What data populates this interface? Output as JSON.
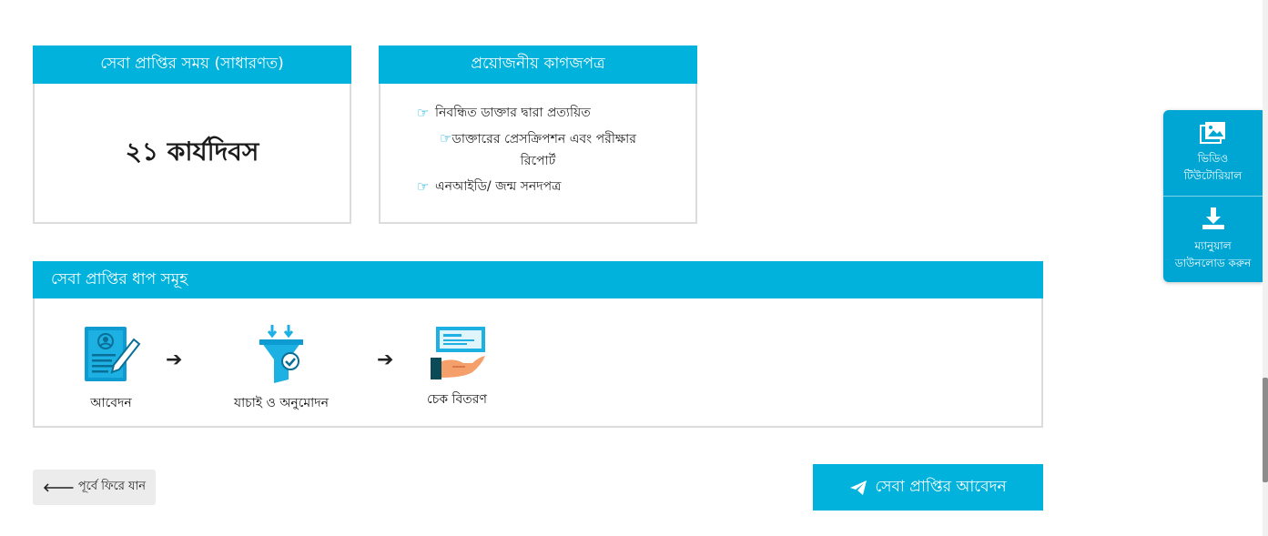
{
  "service_time": {
    "title": "সেবা প্রাপ্তির সময় (সাধারণত)",
    "value": "২১ কার্যদিবস"
  },
  "documents": {
    "title": "প্রয়োজনীয় কাগজপত্র",
    "items": [
      "নিবন্ধিত ডাক্তার দ্বারা প্রত্যয়িত",
      "ডাক্তারের প্রেসক্রিপশন এবং পরীক্ষার রিপোর্ট",
      "এনআইডি/ জন্ম সনদপত্র"
    ],
    "icon": "hand-pointer-right-icon"
  },
  "steps": {
    "title": "সেবা প্রাপ্তির ধাপ সমূহ",
    "items": [
      {
        "label": "আবেদন",
        "icon": "application-form-icon"
      },
      {
        "label": "যাচাই ও অনুমোদন",
        "icon": "filter-verify-icon"
      },
      {
        "label": "চেক বিতরণ",
        "icon": "cheque-hand-icon"
      }
    ]
  },
  "actions": {
    "back_label": "পূর্বে ফিরে যান",
    "apply_label": "সেবা প্রাপ্তির আবেদন"
  },
  "side_widget": {
    "video_label_1": "ভিডিও",
    "video_label_2": "টিউটোরিয়াল",
    "manual_label_1": "ম্যানুয়াল",
    "manual_label_2": "ডাউনলোড করুন"
  },
  "colors": {
    "accent": "#00b2dc",
    "side_widget": "#00a6d3",
    "border": "#dcdcdc",
    "back_button": "#ececec"
  }
}
